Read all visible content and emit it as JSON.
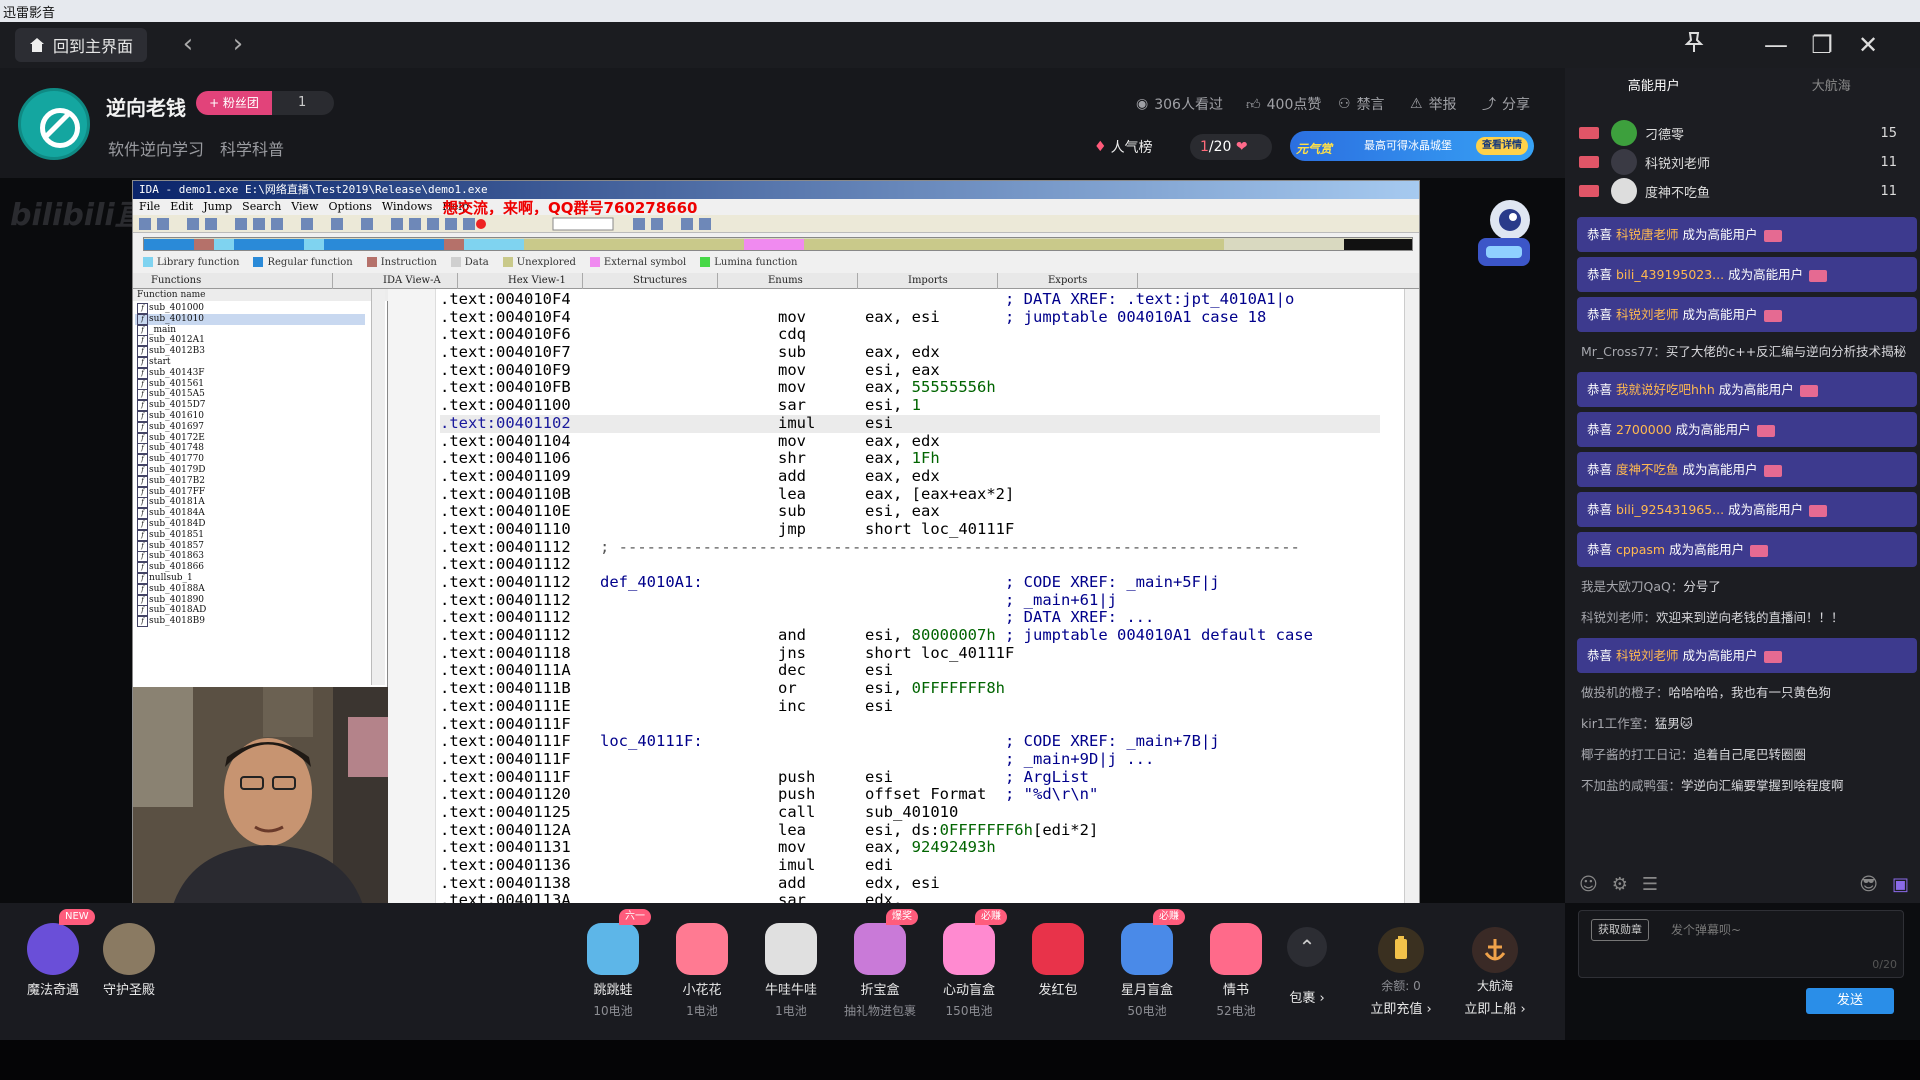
{
  "app_title": "迅雷影音",
  "topbar": {
    "home_label": "回到主界面",
    "back_arrow": "‹",
    "forward_arrow": "›"
  },
  "window_controls": {
    "pin": "⊼",
    "minimize": "—",
    "restore": "❐",
    "close": "✕"
  },
  "streamer": {
    "name": "逆向老钱",
    "fan_button": "+ 粉丝团",
    "fan_count": "1",
    "tags": [
      "软件逆向学习",
      "科学科普"
    ],
    "viewers": "306人看过",
    "likes": "400点赞",
    "actions": {
      "mute": "禁言",
      "report": "举报",
      "share": "分享"
    },
    "popularity": "人气榜",
    "rank_current": "1",
    "rank_total": "/20",
    "promo_title": "元气赏",
    "promo_text": "最高可得冰晶城堡",
    "promo_button": "查看详情"
  },
  "video": {
    "watermark": "bilibili直播",
    "ida": {
      "title": "IDA - demo1.exe E:\\网络直播\\Test2019\\Release\\demo1.exe",
      "menu": [
        "File",
        "Edit",
        "Jump",
        "Search",
        "View",
        "Options",
        "Windows",
        "Help"
      ],
      "qq_banner": "想交流，来啊，QQ群号760278660",
      "legend": [
        {
          "label": "Library function",
          "color": "#7fd3f0"
        },
        {
          "label": "Regular function",
          "color": "#2a8ad8"
        },
        {
          "label": "Instruction",
          "color": "#b5716a"
        },
        {
          "label": "Data",
          "color": "#cfcfcf"
        },
        {
          "label": "Unexplored",
          "color": "#c9c98a"
        },
        {
          "label": "External symbol",
          "color": "#f08af0"
        },
        {
          "label": "Lumina function",
          "color": "#48d848"
        }
      ],
      "tabs": [
        "Functions",
        "IDA View-A",
        "Hex View-1",
        "Structures",
        "Enums",
        "Imports",
        "Exports"
      ],
      "func_header": "Function name",
      "functions": [
        "sub_401000",
        "sub_401010",
        "_main",
        "sub_4012A1",
        "sub_4012B3",
        "start",
        "sub_40143F",
        "sub_401561",
        "sub_4015A5",
        "sub_4015D7",
        "sub_401610",
        "sub_401697",
        "sub_40172E",
        "sub_401748",
        "sub_401770",
        "sub_40179D",
        "sub_4017B2",
        "sub_4017FF",
        "sub_40181A",
        "sub_40184A",
        "sub_40184D",
        "sub_401851",
        "sub_401857",
        "sub_401863",
        "sub_401866",
        "nullsub_1",
        "sub_40188A",
        "sub_401890",
        "sub_4018AD",
        "sub_4018B9"
      ],
      "code": [
        {
          "a": ".text:004010F4",
          "cm": "; DATA XREF: .text:jpt_4010A1|o"
        },
        {
          "a": ".text:004010F4",
          "mn": "mov",
          "op": "eax, esi",
          "cm": "; jumptable 004010A1 case 18"
        },
        {
          "a": ".text:004010F6",
          "mn": "cdq"
        },
        {
          "a": ".text:004010F7",
          "mn": "sub",
          "op": "eax, edx"
        },
        {
          "a": ".text:004010F9",
          "mn": "mov",
          "op": "esi, eax"
        },
        {
          "a": ".text:004010FB",
          "mn": "mov",
          "op": "eax, ",
          "opg": "55555556h"
        },
        {
          "a": ".text:00401100",
          "mn": "sar",
          "op": "esi, ",
          "opg": "1"
        },
        {
          "a": ".text:00401102",
          "mn": "imul",
          "op": "esi",
          "hl": true
        },
        {
          "a": ".text:00401104",
          "mn": "mov",
          "op": "eax, edx"
        },
        {
          "a": ".text:00401106",
          "mn": "shr",
          "op": "eax, ",
          "opg": "1Fh"
        },
        {
          "a": ".text:00401109",
          "mn": "add",
          "op": "eax, edx"
        },
        {
          "a": ".text:0040110B",
          "mn": "lea",
          "op": "eax, [eax+eax*2]"
        },
        {
          "a": ".text:0040110E",
          "mn": "sub",
          "op": "esi, eax"
        },
        {
          "a": ".text:00401110",
          "mn": "jmp",
          "op": "short loc_40111F"
        },
        {
          "a": ".text:00401112",
          "dash": "; -------------------------------------------------------------------------"
        },
        {
          "a": ".text:00401112"
        },
        {
          "a": ".text:00401112",
          "lbl": "def_4010A1:",
          "cm": "; CODE XREF: _main+5F|j"
        },
        {
          "a": ".text:00401112",
          "cm": "; _main+61|j"
        },
        {
          "a": ".text:00401112",
          "cm": "; DATA XREF: ..."
        },
        {
          "a": ".text:00401112",
          "mn": "and",
          "op": "esi, ",
          "opg": "80000007h",
          "cm": "; jumptable 004010A1 default case"
        },
        {
          "a": ".text:00401118",
          "mn": "jns",
          "op": "short loc_40111F"
        },
        {
          "a": ".text:0040111A",
          "mn": "dec",
          "op": "esi"
        },
        {
          "a": ".text:0040111B",
          "mn": "or",
          "op": "esi, ",
          "opg": "0FFFFFFF8h"
        },
        {
          "a": ".text:0040111E",
          "mn": "inc",
          "op": "esi"
        },
        {
          "a": ".text:0040111F"
        },
        {
          "a": ".text:0040111F",
          "lbl": "loc_40111F:",
          "cm": "; CODE XREF: _main+7B|j"
        },
        {
          "a": ".text:0040111F",
          "cm": "; _main+9D|j ..."
        },
        {
          "a": ".text:0040111F",
          "mn": "push",
          "op": "esi",
          "cm": "; ArgList"
        },
        {
          "a": ".text:00401120",
          "mn": "push",
          "op": "offset Format",
          "cm": "; \"%d\\r\\n\""
        },
        {
          "a": ".text:00401125",
          "mn": "call",
          "op": "sub_401010"
        },
        {
          "a": ".text:0040112A",
          "mn": "lea",
          "op": "esi, ds:",
          "opg": "0FFFFFFF6h",
          "op2": "[edi*2]"
        },
        {
          "a": ".text:00401131",
          "mn": "mov",
          "op": "eax, ",
          "opg": "92492493h"
        },
        {
          "a": ".text:00401136",
          "mn": "imul",
          "op": "edi"
        },
        {
          "a": ".text:00401138",
          "mn": "add",
          "op": "edx, esi"
        },
        {
          "a": ".text:0040113A",
          "mn": "sar",
          "op": "edx, "
        }
      ]
    }
  },
  "chat": {
    "tabs": [
      "高能用户",
      "大航海"
    ],
    "high_users": [
      {
        "name": "刁德零",
        "count": "15"
      },
      {
        "name": "科锐刘老师",
        "count": "11"
      },
      {
        "name": "度神不吃鱼",
        "count": "11"
      }
    ],
    "messages": [
      {
        "kind": "vip",
        "prefix": "恭喜",
        "user": "科锐唐老师",
        "suffix": "成为高能用户"
      },
      {
        "kind": "vip",
        "prefix": "恭喜",
        "user": "bili_439195023...",
        "suffix": "成为高能用户"
      },
      {
        "kind": "vip",
        "prefix": "恭喜",
        "user": "科锐刘老师",
        "suffix": "成为高能用户"
      },
      {
        "kind": "text",
        "user": "Mr_Cross77：",
        "text": "买了大佬的c++反汇编与逆向分析技术揭秘"
      },
      {
        "kind": "vip",
        "prefix": "恭喜",
        "user": "我就说好吃吧hhh",
        "suffix": "成为高能用户"
      },
      {
        "kind": "vip",
        "prefix": "恭喜",
        "user": "2700000",
        "suffix": "成为高能用户"
      },
      {
        "kind": "vip",
        "prefix": "恭喜",
        "user": "度神不吃鱼",
        "suffix": "成为高能用户"
      },
      {
        "kind": "vip",
        "prefix": "恭喜",
        "user": "bili_925431965...",
        "suffix": "成为高能用户"
      },
      {
        "kind": "vip",
        "prefix": "恭喜",
        "user": "cppasm",
        "suffix": "成为高能用户"
      },
      {
        "kind": "text",
        "user": "我是大欧刀QaQ：",
        "text": "分号了"
      },
      {
        "kind": "text",
        "user": "科锐刘老师：",
        "text": "欢迎来到逆向老钱的直播间！！！"
      },
      {
        "kind": "vip",
        "prefix": "恭喜",
        "user": "科锐刘老师",
        "suffix": "成为高能用户"
      },
      {
        "kind": "text",
        "user": "做投机的橙子：",
        "text": "哈哈哈哈，我也有一只黄色狗"
      },
      {
        "kind": "text",
        "user": "kir1工作室：",
        "text": "猛男🐱"
      },
      {
        "kind": "text",
        "user": "椰子酱的打工日记：",
        "text": "追着自己尾巴转圈圈"
      },
      {
        "kind": "text",
        "user": "不加盐的咸鸭蛋：",
        "text": "学逆向汇编要掌握到啥程度啊"
      }
    ],
    "medal_button": "获取勋章",
    "input_placeholder": "发个弹幕呗~",
    "char_count": "0/20",
    "send_button": "发送"
  },
  "gifts_left": [
    {
      "name": "魔法奇遇",
      "badge": "NEW",
      "color": "#6a4fd8"
    },
    {
      "name": "守护圣殿",
      "color": "#8a7a62"
    }
  ],
  "gifts": [
    {
      "name": "跳跳蛙",
      "price": "10电池",
      "badge": "六一",
      "color": "#5db6e8"
    },
    {
      "name": "小花花",
      "price": "1电池",
      "color": "#ff7a92"
    },
    {
      "name": "牛哇牛哇",
      "price": "1电池",
      "color": "#e0e0e0"
    },
    {
      "name": "折宝盒",
      "price": "抽礼物进包裹",
      "badge": "爆奖",
      "color": "#c97ad8"
    },
    {
      "name": "心动盲盒",
      "price": "150电池",
      "badge": "必赚",
      "color": "#ff8ad0"
    },
    {
      "name": "发红包",
      "price": "",
      "color": "#e8334a"
    },
    {
      "name": "星月盲盒",
      "price": "50电池",
      "badge": "必赚",
      "color": "#4a8ae8"
    },
    {
      "name": "情书",
      "price": "52电池",
      "color": "#ff6a8a"
    }
  ],
  "gift_pack": {
    "label": "包裹 ›",
    "arrow": "⌃"
  },
  "recharge": {
    "balance": "余额: 0",
    "action": "立即充值 ›"
  },
  "fleet": {
    "label": "大航海",
    "action": "立即上船 ›"
  }
}
